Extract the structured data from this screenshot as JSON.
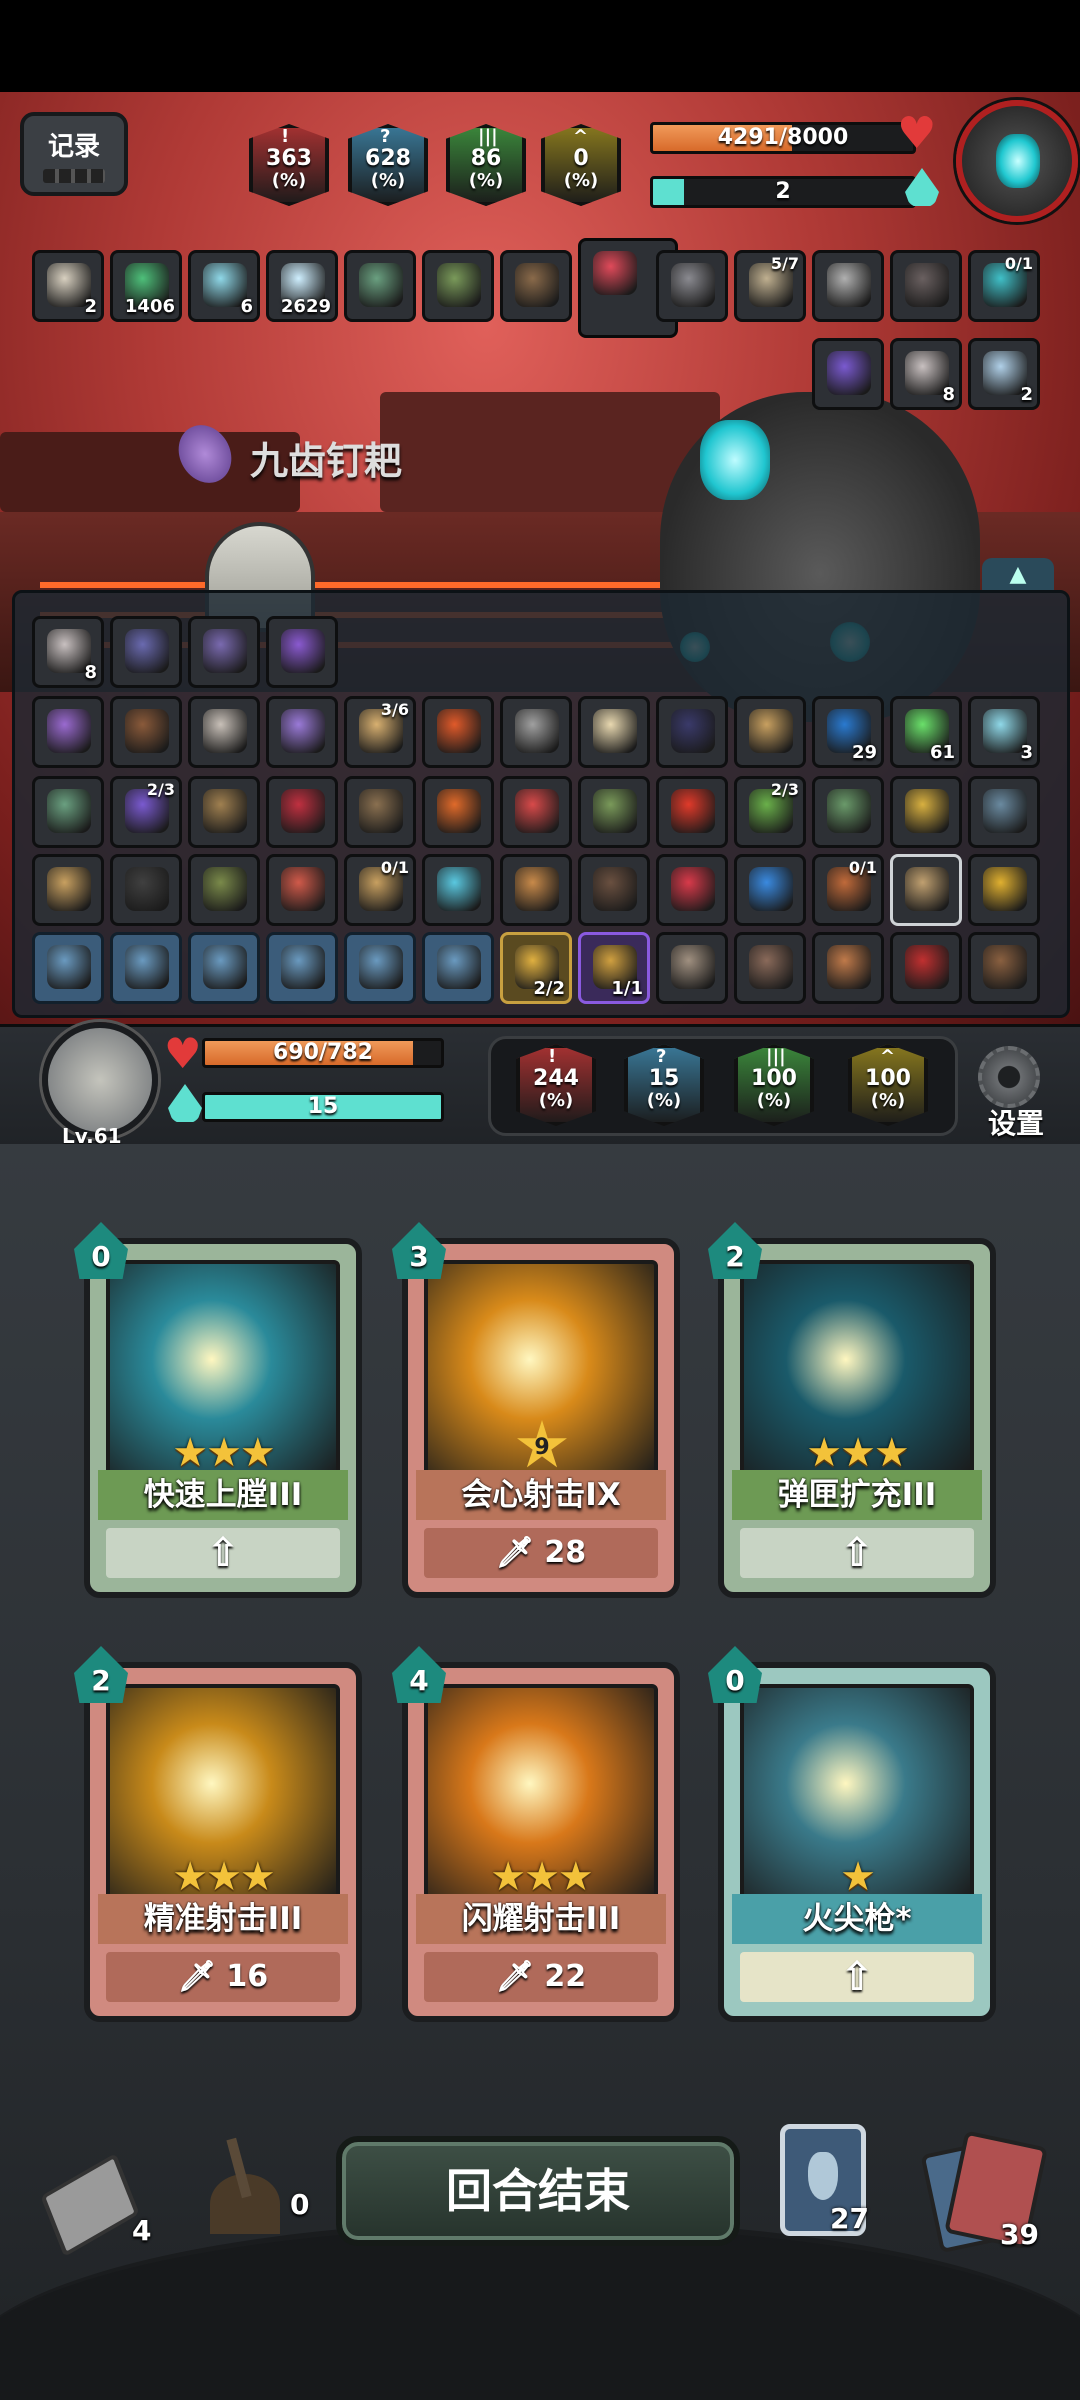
{
  "top_stats": [
    {
      "value": "363",
      "unit": "(%)",
      "color": "#a83232",
      "glyph": "!"
    },
    {
      "value": "628",
      "unit": "(%)",
      "color": "#3a7a9a",
      "glyph": "?"
    },
    {
      "value": "86",
      "unit": "(%)",
      "color": "#3c8a3c",
      "glyph": "|||"
    },
    {
      "value": "0",
      "unit": "(%)",
      "color": "#8a7a1e",
      "glyph": "^"
    }
  ],
  "record_button": "记录",
  "boss": {
    "hp_text": "4291/8000",
    "hp_fraction": 0.536,
    "energy_text": "2",
    "energy_fraction": 0.12
  },
  "relics_row1": [
    {
      "name": "scroll-icon",
      "count": "2",
      "color": "#d8d0c0"
    },
    {
      "name": "skull-icon",
      "count": "1406",
      "color": "#4ec07a"
    },
    {
      "name": "crosshair-icon",
      "count": "6",
      "color": "#8fd8e8"
    },
    {
      "name": "snowflake-icon",
      "count": "2629",
      "color": "#cfefff"
    },
    {
      "name": "fish-icon",
      "count": "",
      "color": "#6aa080"
    },
    {
      "name": "plant-monster-icon",
      "count": "",
      "color": "#7a9a5a"
    },
    {
      "name": "book-icon",
      "count": "",
      "color": "#8a6a4a"
    },
    {
      "name": "red-creature-icon",
      "count": "",
      "color": "#e04a5a"
    },
    {
      "name": "crossbow-icon",
      "count": "",
      "color": "#8a8a90"
    },
    {
      "name": "clock-icon",
      "frac": "5/7",
      "color": "#c0b090"
    },
    {
      "name": "fan-icon",
      "count": "",
      "color": "#b0b0b0"
    },
    {
      "name": "wing-icon",
      "count": "",
      "color": "#6a6060"
    },
    {
      "name": "ring-icon",
      "frac": "0/1",
      "color": "#40c0c8"
    }
  ],
  "relics_row2": [
    {
      "name": "purple-crystal-icon",
      "count": "",
      "color": "#7a5ad0"
    },
    {
      "name": "target-disc-icon",
      "count": "8",
      "color": "#c8c0c0"
    },
    {
      "name": "orb-icon",
      "count": "2",
      "color": "#b0d0e8"
    }
  ],
  "selected_item_name": "九齿钉耙",
  "inventory_row0": [
    {
      "name": "target-disc-icon",
      "count": "8",
      "color": "#c8c0c0",
      "style": ""
    },
    {
      "name": "purple-plate-icon",
      "count": "",
      "color": "#6a6ab0",
      "style": ""
    },
    {
      "name": "hex-rune-icon",
      "count": "",
      "color": "#7a6ab0",
      "style": ""
    },
    {
      "name": "purple-gem-icon",
      "count": "",
      "color": "#8a5ad0",
      "style": ""
    }
  ],
  "inventory_row1": [
    {
      "name": "gear-wand-icon",
      "count": "",
      "color": "#9a6ad0",
      "style": ""
    },
    {
      "name": "hat-icon",
      "count": "",
      "color": "#8a5a3a",
      "style": ""
    },
    {
      "name": "mask-icon",
      "count": "",
      "color": "#c8c0b8",
      "style": ""
    },
    {
      "name": "purple-orb-icon",
      "count": "",
      "color": "#9a7ad8",
      "style": ""
    },
    {
      "name": "scroll-icon",
      "frac": "3/6",
      "color": "#d8b070",
      "style": ""
    },
    {
      "name": "fire-stone-icon",
      "count": "",
      "color": "#e05a2a",
      "style": ""
    },
    {
      "name": "hammer-icon",
      "count": "",
      "color": "#a0a0a0",
      "style": ""
    },
    {
      "name": "dice-icon",
      "count": "",
      "color": "#e8d8b0",
      "style": ""
    },
    {
      "name": "dark-gem-icon",
      "count": "",
      "color": "#3a3a6a",
      "style": ""
    },
    {
      "name": "scales-icon",
      "count": "",
      "color": "#c8a060",
      "style": ""
    },
    {
      "name": "shield-icon",
      "count": "29",
      "color": "#2a7ad0",
      "style": ""
    },
    {
      "name": "green-blade-icon",
      "count": "61",
      "color": "#6ae06a",
      "style": ""
    },
    {
      "name": "crosshair-icon",
      "count": "3",
      "color": "#8fd8e8",
      "style": ""
    }
  ],
  "inventory_row2": [
    {
      "name": "fish-icon",
      "count": "",
      "color": "#6aa080",
      "style": ""
    },
    {
      "name": "spellbook-icon",
      "frac": "2/3",
      "color": "#7a5ad0",
      "style": ""
    },
    {
      "name": "rifle-icon",
      "count": "",
      "color": "#a08050",
      "style": ""
    },
    {
      "name": "red-stick-icon",
      "count": "",
      "color": "#c03040",
      "style": ""
    },
    {
      "name": "potion-bag-icon",
      "count": "",
      "color": "#8a7050",
      "style": ""
    },
    {
      "name": "fire-staff-icon",
      "count": "",
      "color": "#e06a2a",
      "style": ""
    },
    {
      "name": "clown-icon",
      "count": "",
      "color": "#d84a4a",
      "style": ""
    },
    {
      "name": "plant-monster-icon",
      "count": "",
      "color": "#7a9a5a",
      "style": ""
    },
    {
      "name": "red-apple-icon",
      "count": "",
      "color": "#e03a2a",
      "style": ""
    },
    {
      "name": "seedling-icon",
      "frac": "2/3",
      "color": "#6ab04a",
      "style": ""
    },
    {
      "name": "green-jar-icon",
      "count": "",
      "color": "#6a9a6a",
      "style": ""
    },
    {
      "name": "compass-icon",
      "count": "",
      "color": "#d8b040",
      "style": ""
    },
    {
      "name": "hammer-blue-icon",
      "count": "",
      "color": "#6a8aa0",
      "style": ""
    }
  ],
  "inventory_row3": [
    {
      "name": "hourglass-icon",
      "count": "",
      "color": "#c8a060",
      "style": ""
    },
    {
      "name": "net-icon",
      "count": "",
      "color": "#404040",
      "style": ""
    },
    {
      "name": "egg-icon",
      "count": "",
      "color": "#7a8a4a",
      "style": ""
    },
    {
      "name": "doll-icon",
      "count": "",
      "color": "#d05a4a",
      "style": ""
    },
    {
      "name": "gourd-icon",
      "frac": "0/1",
      "color": "#c8a060",
      "style": ""
    },
    {
      "name": "whirlwind-icon",
      "count": "",
      "color": "#5ac8e0",
      "style": ""
    },
    {
      "name": "bread-icon",
      "count": "",
      "color": "#c88a4a",
      "style": ""
    },
    {
      "name": "brush-icon",
      "count": "",
      "color": "#6a5040",
      "style": ""
    },
    {
      "name": "red-bottle-icon",
      "count": "",
      "color": "#d83a4a",
      "style": ""
    },
    {
      "name": "wave-icon",
      "count": "",
      "color": "#3a8ae0",
      "style": ""
    },
    {
      "name": "bag-icon",
      "frac": "0/1",
      "color": "#c06a3a",
      "style": ""
    },
    {
      "name": "knight-icon",
      "count": "",
      "color": "#c0a070",
      "style": "sel"
    },
    {
      "name": "horn-icon",
      "count": "",
      "color": "#e0b030",
      "style": ""
    }
  ],
  "inventory_row4": [
    {
      "name": "pistol-icon",
      "count": "",
      "color": "#6a9ac0",
      "style": "blue"
    },
    {
      "name": "crossbow-icon",
      "count": "",
      "color": "#6a9ac0",
      "style": "blue"
    },
    {
      "name": "dragon-icon",
      "count": "",
      "color": "#6a9ac0",
      "style": "blue"
    },
    {
      "name": "skull-icon",
      "count": "",
      "color": "#6a9ac0",
      "style": "blue"
    },
    {
      "name": "glove-icon",
      "count": "",
      "color": "#6a9ac0",
      "style": "blue"
    },
    {
      "name": "dual-guns-icon",
      "count": "",
      "color": "#6a9ac0",
      "style": "blue"
    },
    {
      "name": "bullet-icon",
      "count": "2/2",
      "color": "#e0b040",
      "style": "gold"
    },
    {
      "name": "bullet-purple-icon",
      "count": "1/1",
      "color": "#d0a040",
      "style": "purple"
    },
    {
      "name": "robot-icon",
      "count": "",
      "color": "#a09080",
      "style": ""
    },
    {
      "name": "puppet-icon",
      "count": "",
      "color": "#8a6a5a",
      "style": ""
    },
    {
      "name": "mech-icon",
      "count": "",
      "color": "#c07a4a",
      "style": ""
    },
    {
      "name": "boxing-glove-icon",
      "count": "",
      "color": "#c03030",
      "style": ""
    },
    {
      "name": "owl-icon",
      "count": "",
      "color": "#8a6040",
      "style": ""
    }
  ],
  "player": {
    "level": "Lv.61",
    "hp_text": "690/782",
    "hp_fraction": 0.882,
    "energy_text": "15",
    "energy_fraction": 1.0
  },
  "player_stats": [
    {
      "value": "244",
      "unit": "(%)",
      "color": "#a83232",
      "glyph": "!"
    },
    {
      "value": "15",
      "unit": "(%)",
      "color": "#3a7a9a",
      "glyph": "?"
    },
    {
      "value": "100",
      "unit": "(%)",
      "color": "#3c8a3c",
      "glyph": "|||"
    },
    {
      "value": "100",
      "unit": "(%)",
      "color": "#8a7a1e",
      "glyph": "^"
    }
  ],
  "settings_label": "设置",
  "cards": [
    {
      "cost": "0",
      "title": "快速上膛III",
      "footer": "",
      "stars": "★★★",
      "variant": "green",
      "art_color": "#2a8a9a"
    },
    {
      "cost": "3",
      "title": "会心射击IX",
      "footer": "28",
      "stars": "",
      "level_badge": "9",
      "variant": "red",
      "art_color": "#d88a1a"
    },
    {
      "cost": "2",
      "title": "弹匣扩充III",
      "footer": "",
      "stars": "★★★",
      "variant": "green",
      "art_color": "#1a5a6a"
    },
    {
      "cost": "2",
      "title": "精准射击III",
      "footer": "16",
      "stars": "★★★",
      "variant": "red",
      "art_color": "#c88a1a"
    },
    {
      "cost": "4",
      "title": "闪耀射击III",
      "footer": "22",
      "stars": "★★★",
      "variant": "red",
      "art_color": "#d8781a"
    },
    {
      "cost": "0",
      "title": "火尖枪*",
      "footer": "",
      "stars": "★",
      "variant": "teal",
      "art_color": "#3a7a8a"
    }
  ],
  "end_turn_label": "回合结束",
  "piles": {
    "exhaust_count": "4",
    "grave_count": "0",
    "potion_count": "27",
    "draw_count": "39"
  }
}
